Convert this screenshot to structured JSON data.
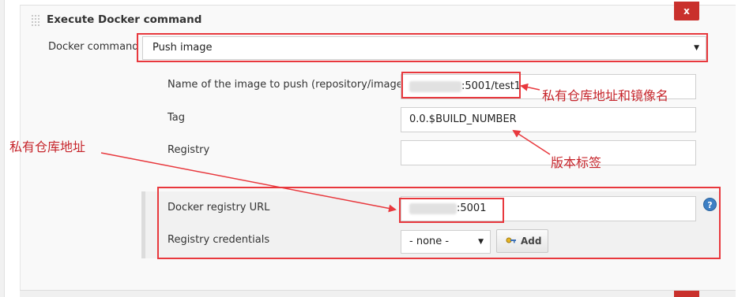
{
  "step": {
    "title": "Execute Docker command",
    "delete_label": "x"
  },
  "form": {
    "docker_command": {
      "label": "Docker command",
      "value": "Push image"
    },
    "image_name": {
      "label": "Name of the image to push (repository/image)",
      "value_suffix": ":5001/test1"
    },
    "tag": {
      "label": "Tag",
      "value": "0.0.$BUILD_NUMBER"
    },
    "registry": {
      "label": "Registry",
      "value": ""
    },
    "registry_url": {
      "label": "Docker registry URL",
      "value_suffix": ":5001"
    },
    "registry_credentials": {
      "label": "Registry credentials",
      "value": "- none -",
      "add_label": "Add"
    }
  },
  "annotations": {
    "image_note": "私有仓库地址和镜像名",
    "tag_note": "版本标签",
    "registry_note": "私有仓库地址"
  },
  "icons": {
    "caret": "▼",
    "help": "?",
    "delete": "x",
    "key": "key-icon"
  },
  "colors": {
    "annotation_red": "#e8383d",
    "delete_button": "#c9302c",
    "help_blue": "#3d7fc4"
  }
}
